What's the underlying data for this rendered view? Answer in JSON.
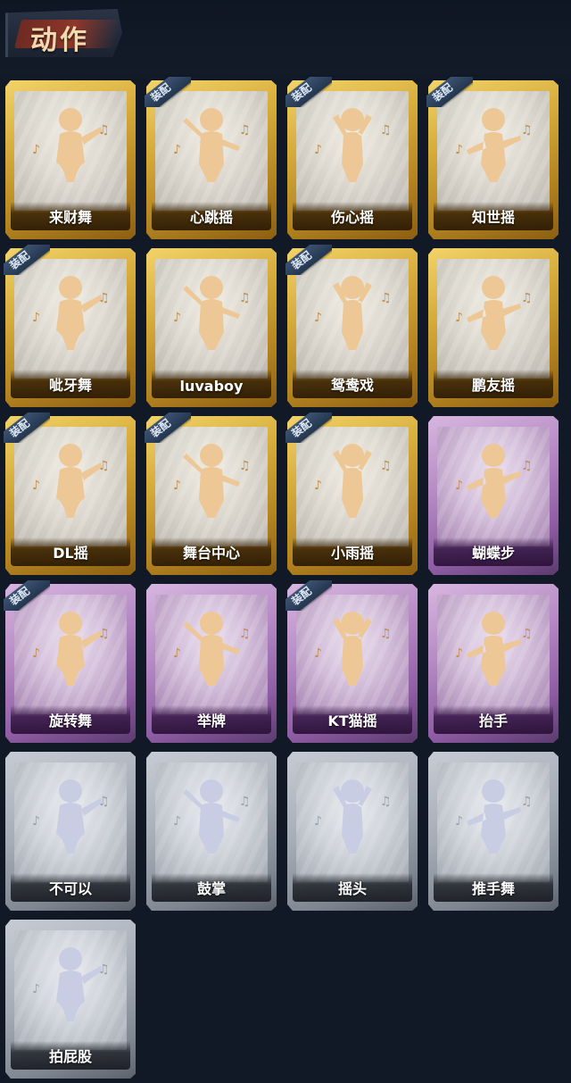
{
  "header": {
    "title": "动作"
  },
  "equip_label": "装配",
  "colors": {
    "gold": "#d6ac3a",
    "purple": "#a97bbb",
    "gray": "#a5acb6",
    "figure_gold": "#edc796",
    "figure_ghost": "#c8cde4"
  },
  "actions": [
    {
      "name": "来财舞",
      "rarity": "gold",
      "equipped": false,
      "icon": "money-dance-icon"
    },
    {
      "name": "心跳摇",
      "rarity": "gold",
      "equipped": true,
      "icon": "heartbeat-dance-icon"
    },
    {
      "name": "伤心摇",
      "rarity": "gold",
      "equipped": true,
      "icon": "heart-hands-icon"
    },
    {
      "name": "知世摇",
      "rarity": "gold",
      "equipped": true,
      "icon": "music-dance-icon"
    },
    {
      "name": "呲牙舞",
      "rarity": "gold",
      "equipped": true,
      "icon": "grin-dance-icon"
    },
    {
      "name": "luvaboy",
      "rarity": "gold",
      "equipped": false,
      "icon": "luvaboy-dance-icon"
    },
    {
      "name": "鸳鸯戏",
      "rarity": "gold",
      "equipped": true,
      "icon": "mandarin-duck-dance-icon"
    },
    {
      "name": "鹏友摇",
      "rarity": "gold",
      "equipped": false,
      "icon": "friend-dance-icon"
    },
    {
      "name": "DL摇",
      "rarity": "gold",
      "equipped": true,
      "icon": "dl-dance-icon"
    },
    {
      "name": "舞台中心",
      "rarity": "gold",
      "equipped": true,
      "icon": "center-stage-icon"
    },
    {
      "name": "小雨摇",
      "rarity": "gold",
      "equipped": true,
      "icon": "light-rain-dance-icon"
    },
    {
      "name": "蝴蝶步",
      "rarity": "purple",
      "equipped": false,
      "icon": "butterfly-step-icon"
    },
    {
      "name": "旋转舞",
      "rarity": "purple",
      "equipped": true,
      "icon": "spin-dance-icon"
    },
    {
      "name": "举牌",
      "rarity": "purple",
      "equipped": false,
      "icon": "hold-sign-icon"
    },
    {
      "name": "KT猫摇",
      "rarity": "purple",
      "equipped": true,
      "icon": "kt-cat-dance-icon"
    },
    {
      "name": "抬手",
      "rarity": "purple",
      "equipped": false,
      "icon": "raise-hand-icon"
    },
    {
      "name": "不可以",
      "rarity": "gray",
      "equipped": false,
      "icon": "no-finger-icon"
    },
    {
      "name": "鼓掌",
      "rarity": "gray",
      "equipped": false,
      "icon": "clap-icon"
    },
    {
      "name": "摇头",
      "rarity": "gray",
      "equipped": false,
      "icon": "shake-head-icon"
    },
    {
      "name": "推手舞",
      "rarity": "gray",
      "equipped": false,
      "icon": "push-hand-dance-icon"
    },
    {
      "name": "拍屁股",
      "rarity": "gray",
      "equipped": false,
      "icon": "slap-butt-icon"
    }
  ]
}
